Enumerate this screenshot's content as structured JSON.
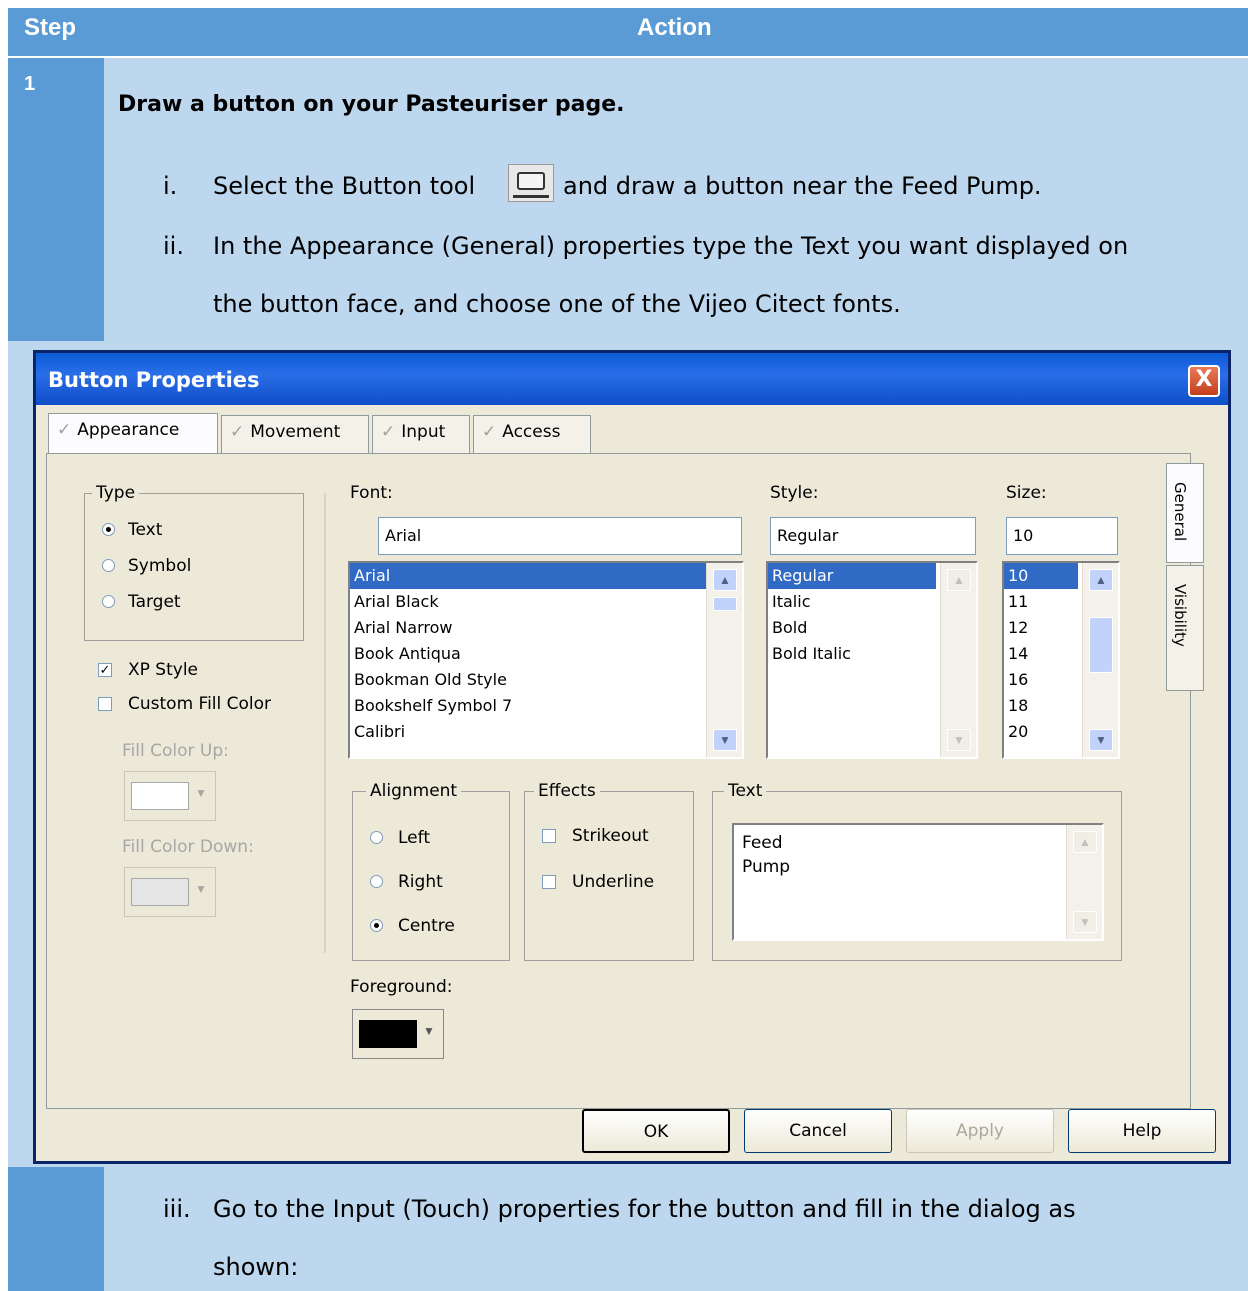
{
  "table": {
    "header": {
      "step": "Step",
      "action": "Action"
    },
    "row1": {
      "step": "1",
      "heading": "Draw a button on your Pasteuriser page.",
      "items": [
        {
          "num": "i.",
          "before": "Select the Button tool",
          "after": "and draw a button near the Feed Pump."
        },
        {
          "num": "ii.",
          "line1": "In the Appearance (General) properties type the Text you want displayed on",
          "line2": "the button face, and choose one of the Vijeo Citect fonts."
        }
      ]
    },
    "row2": {
      "items": [
        {
          "num": "iii.",
          "line1": "Go to the Input (Touch) properties for the button and fill in the dialog as",
          "line2": "shown:"
        }
      ]
    }
  },
  "dialog": {
    "title": "Button Properties",
    "close": "X",
    "tabs": [
      "Appearance",
      "Movement",
      "Input",
      "Access"
    ],
    "side_tabs": [
      "General",
      "Visibility"
    ],
    "type": {
      "label": "Type",
      "options": [
        "Text",
        "Symbol",
        "Target"
      ],
      "selected": "Text"
    },
    "xp_style": {
      "label": "XP Style",
      "checked": true
    },
    "custom_fill": {
      "label": "Custom Fill Color",
      "checked": false
    },
    "fill_up_label": "Fill Color Up:",
    "fill_down_label": "Fill Color Down:",
    "font": {
      "label": "Font:",
      "value": "Arial",
      "options": [
        "Arial",
        "Arial Black",
        "Arial Narrow",
        "Book Antiqua",
        "Bookman Old Style",
        "Bookshelf Symbol 7",
        "Calibri"
      ]
    },
    "style": {
      "label": "Style:",
      "value": "Regular",
      "options": [
        "Regular",
        "Italic",
        "Bold",
        "Bold Italic"
      ]
    },
    "size": {
      "label": "Size:",
      "value": "10",
      "options": [
        "10",
        "11",
        "12",
        "14",
        "16",
        "18",
        "20"
      ]
    },
    "alignment": {
      "label": "Alignment",
      "options": [
        "Left",
        "Right",
        "Centre"
      ],
      "selected": "Centre"
    },
    "effects": {
      "label": "Effects",
      "options": [
        "Strikeout",
        "Underline"
      ]
    },
    "text": {
      "label": "Text",
      "lines": [
        "Feed",
        "Pump"
      ]
    },
    "foreground_label": "Foreground:",
    "colors": {
      "foreground": "#000000",
      "accent": "#316ac5",
      "header": "#5b9bd5",
      "row": "#bdd7ee"
    },
    "buttons": {
      "ok": "OK",
      "cancel": "Cancel",
      "apply": "Apply",
      "help": "Help"
    }
  }
}
